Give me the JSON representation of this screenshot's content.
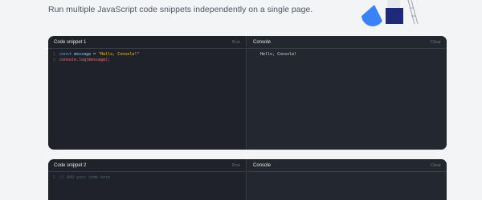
{
  "page": {
    "subtitle": "Run multiple JavaScript code snippets independently on a single page."
  },
  "snippets": [
    {
      "title": "Code snippet 1",
      "run_label": "Run",
      "console_title": "Console",
      "clear_label": "Clear",
      "code": {
        "line1_no": "1",
        "line1_kw": "const",
        "line1_var": "message",
        "line1_op": " = ",
        "line1_str": "\"Hello, Console!\"",
        "line2_no": "2",
        "line2_text": "console.log(message);"
      },
      "output": "Hello, Console!"
    },
    {
      "title": "Code snippet 2",
      "run_label": "Run",
      "console_title": "Console",
      "clear_label": "Clear",
      "code": {
        "line1_no": "1",
        "line1_comment": "// Add your code here"
      },
      "output": ""
    }
  ],
  "colors": {
    "card_bg": "#1f2329",
    "console_bg": "#23282e",
    "keyword": "#60a5fa",
    "string": "#fbbf24",
    "function": "#f87171",
    "illustration_blue": "#3b82f6",
    "illustration_navy": "#1e2a78"
  }
}
